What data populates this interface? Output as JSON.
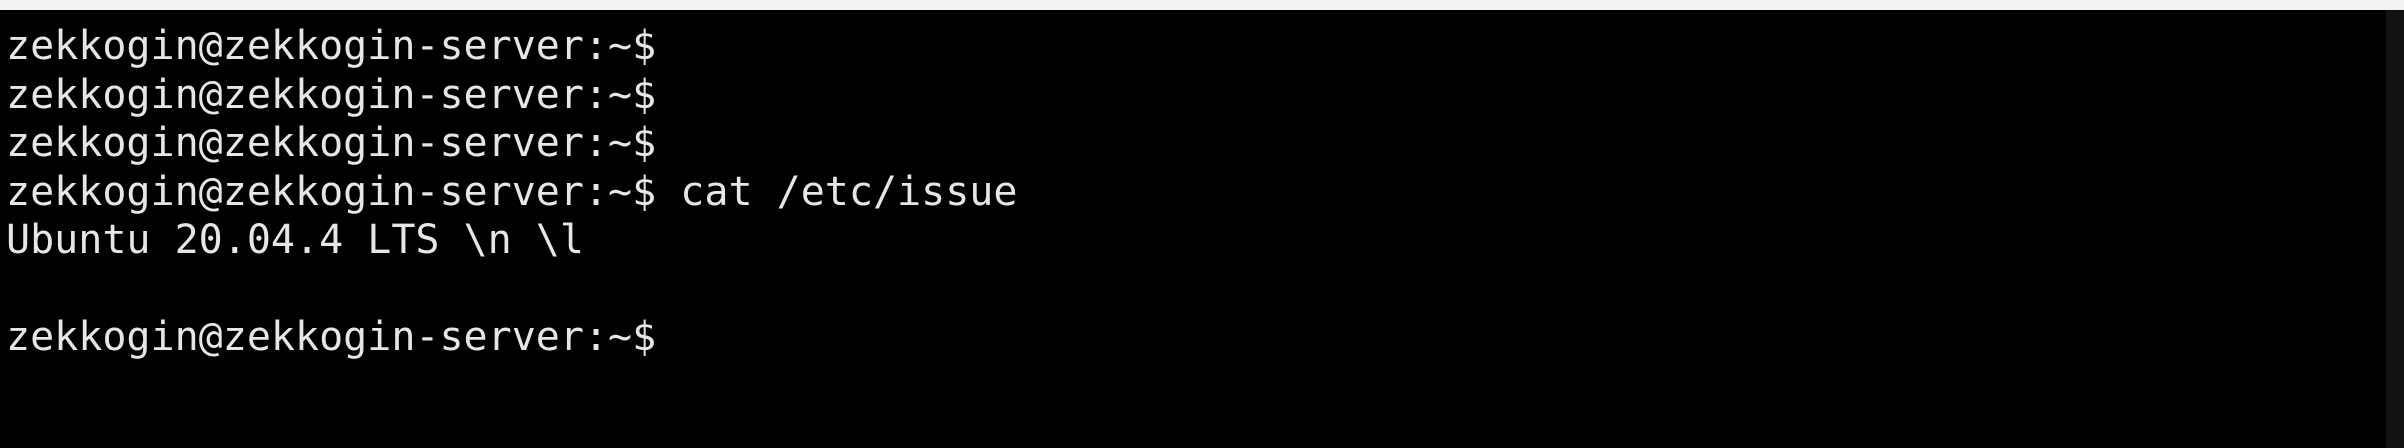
{
  "colors": {
    "background": "#000000",
    "foreground": "#e6e6e6"
  },
  "terminal": {
    "lines": [
      {
        "prompt": "zekkogin@zekkogin-server:~$",
        "command": ""
      },
      {
        "prompt": "zekkogin@zekkogin-server:~$",
        "command": ""
      },
      {
        "prompt": "zekkogin@zekkogin-server:~$",
        "command": ""
      },
      {
        "prompt": "zekkogin@zekkogin-server:~$",
        "command": " cat /etc/issue"
      },
      {
        "prompt": "",
        "command": "Ubuntu 20.04.4 LTS \\n \\l"
      },
      {
        "prompt": "",
        "command": ""
      },
      {
        "prompt": "zekkogin@zekkogin-server:~$",
        "command": ""
      }
    ]
  }
}
